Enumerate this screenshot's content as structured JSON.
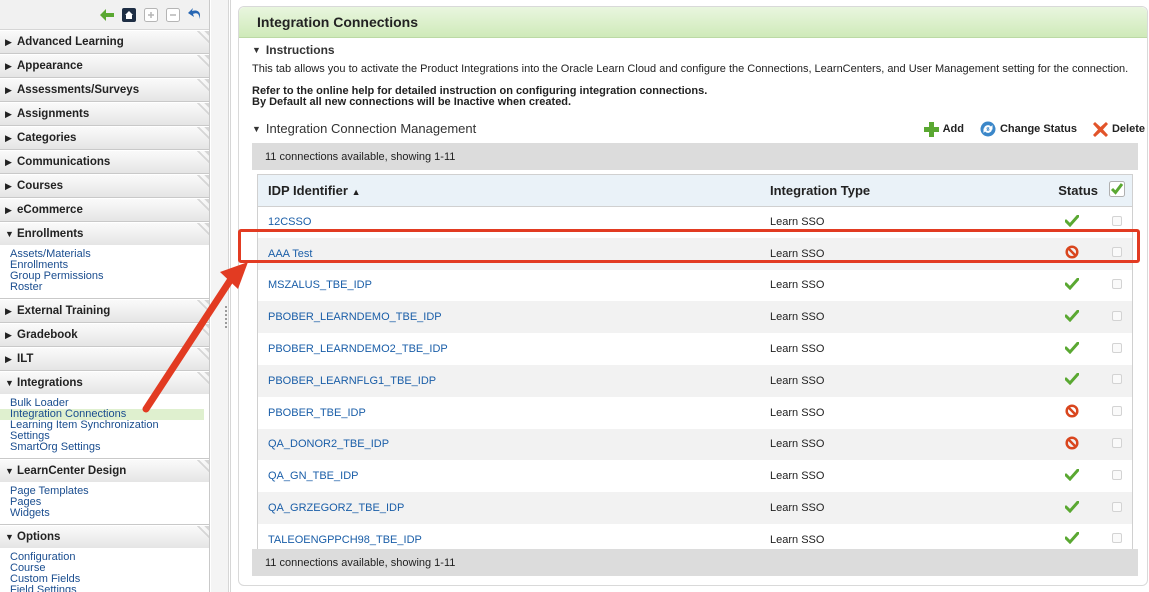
{
  "sidebar": {
    "sections": [
      {
        "label": "Advanced Learning",
        "expanded": false,
        "items": []
      },
      {
        "label": "Appearance",
        "expanded": false,
        "items": []
      },
      {
        "label": "Assessments/Surveys",
        "expanded": false,
        "items": []
      },
      {
        "label": "Assignments",
        "expanded": false,
        "items": []
      },
      {
        "label": "Categories",
        "expanded": false,
        "items": []
      },
      {
        "label": "Communications",
        "expanded": false,
        "items": []
      },
      {
        "label": "Courses",
        "expanded": false,
        "items": []
      },
      {
        "label": "eCommerce",
        "expanded": false,
        "items": []
      },
      {
        "label": "Enrollments",
        "expanded": true,
        "items": [
          "Assets/Materials",
          "Enrollments",
          "Group Permissions",
          "Roster"
        ]
      },
      {
        "label": "External Training",
        "expanded": false,
        "items": []
      },
      {
        "label": "Gradebook",
        "expanded": false,
        "items": []
      },
      {
        "label": "ILT",
        "expanded": false,
        "items": []
      },
      {
        "label": "Integrations",
        "expanded": true,
        "items": [
          "Bulk Loader",
          "Integration Connections",
          "Learning Item Synchronization",
          "Settings",
          "SmartOrg Settings"
        ],
        "active_item": "Integration Connections"
      },
      {
        "label": "LearnCenter Design",
        "expanded": true,
        "items": [
          "Page Templates",
          "Pages",
          "Widgets"
        ]
      },
      {
        "label": "Options",
        "expanded": true,
        "items": [
          "Configuration",
          "Course",
          "Custom Fields",
          "Field Settings"
        ]
      }
    ]
  },
  "main": {
    "title": "Integration Connections",
    "instructions_header": "Instructions",
    "instructions_text": "This tab allows you to activate the Product Integrations into the Oracle Learn Cloud and configure the Connections, LearnCenters, and User Management setting for the connection.",
    "help_line1": "Refer to the online help for detailed instruction on configuring integration connections.",
    "help_line2": "By Default all new connections will be Inactive when created.",
    "mgmt_header": "Integration Connection Management",
    "actions": {
      "add": "Add",
      "change_status": "Change Status",
      "delete": "Delete"
    },
    "count_text": "11 connections available, showing 1-11",
    "table": {
      "headers": {
        "idp": "IDP Identifier",
        "type": "Integration Type",
        "status": "Status"
      },
      "sort_indicator": "▲",
      "rows": [
        {
          "idp": "12CSSO",
          "type": "Learn SSO",
          "status": "active"
        },
        {
          "idp": "AAA Test",
          "type": "Learn SSO",
          "status": "inactive"
        },
        {
          "idp": "MSZALUS_TBE_IDP",
          "type": "Learn SSO",
          "status": "active"
        },
        {
          "idp": "PBOBER_LEARNDEMO_TBE_IDP",
          "type": "Learn SSO",
          "status": "active"
        },
        {
          "idp": "PBOBER_LEARNDEMO2_TBE_IDP",
          "type": "Learn SSO",
          "status": "active"
        },
        {
          "idp": "PBOBER_LEARNFLG1_TBE_IDP",
          "type": "Learn SSO",
          "status": "active"
        },
        {
          "idp": "PBOBER_TBE_IDP",
          "type": "Learn SSO",
          "status": "inactive"
        },
        {
          "idp": "QA_DONOR2_TBE_IDP",
          "type": "Learn SSO",
          "status": "inactive"
        },
        {
          "idp": "QA_GN_TBE_IDP",
          "type": "Learn SSO",
          "status": "active"
        },
        {
          "idp": "QA_GRZEGORZ_TBE_IDP",
          "type": "Learn SSO",
          "status": "active"
        },
        {
          "idp": "TALEOENGPPCH98_TBE_IDP",
          "type": "Learn SSO",
          "status": "active"
        }
      ]
    }
  },
  "colors": {
    "accent_green": "#5aa832",
    "inactive_red": "#d9461e",
    "link_blue": "#1a5ea8",
    "annotation_red": "#e23b22"
  }
}
